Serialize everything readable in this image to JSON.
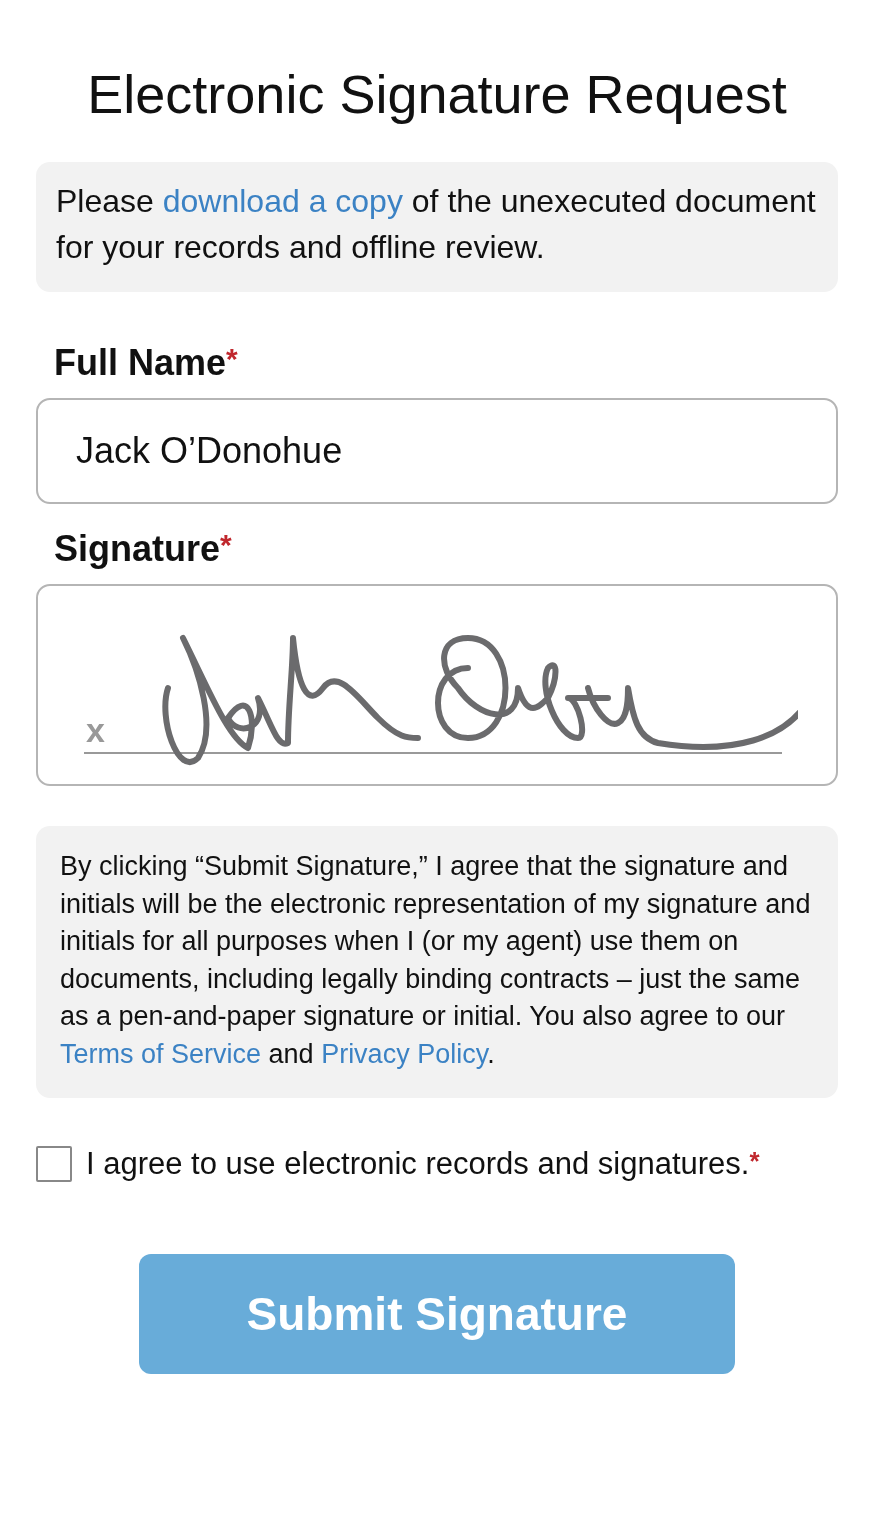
{
  "title": "Electronic Signature Request",
  "notice": [
    {
      "kind": "text",
      "text": "Please "
    },
    {
      "kind": "link",
      "text": "download a copy"
    },
    {
      "kind": "text",
      "text": " of the unexecuted document for your records and offline review."
    }
  ],
  "full_name": {
    "label": "Full Name",
    "required_mark": "*",
    "value": "Jack O’Donohue"
  },
  "signature": {
    "label": "Signature",
    "required_mark": "*",
    "line_mark": "x",
    "signed": true
  },
  "terms": [
    {
      "kind": "text",
      "text": "By clicking “Submit Signature,” I agree that the signature and initials will be the electronic representation of my signature and initials for all purposes when I (or my agent) use them on documents, including legally binding contracts – just the same as a pen-and-paper signature or initial. You also agree to our "
    },
    {
      "kind": "link",
      "text": "Terms of Service"
    },
    {
      "kind": "text",
      "text": " and "
    },
    {
      "kind": "link",
      "text": "Privacy Policy"
    },
    {
      "kind": "text",
      "text": "."
    }
  ],
  "consent": {
    "label": "I agree to use electronic records and signatures.",
    "required_mark": "*",
    "checked": false
  },
  "submit": {
    "label": "Submit Signature",
    "disabled": true
  }
}
